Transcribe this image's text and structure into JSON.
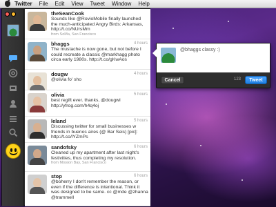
{
  "menubar": {
    "app_name": "Twitter",
    "items": [
      "File",
      "Edit",
      "View",
      "Tweet",
      "Window",
      "Help"
    ]
  },
  "sidebar": {
    "icons": [
      "home-icon",
      "speech-bubble-icon",
      "at-mention-icon",
      "inbox-icon",
      "person-icon",
      "list-icon",
      "search-icon",
      "smiley-icon"
    ]
  },
  "timeline": {
    "tweets": [
      {
        "username": "theSeanCook",
        "time": "",
        "text": "Sounds like @RovioMobile finally launched the much-anticipated Angry Birds: Arkansas, http://t.co/NUrsMm",
        "meta": "from SoMa, San Francisco"
      },
      {
        "username": "bhaggs",
        "time": "4 hours",
        "text": "The mustache is now gone, but not before I could recreate a classic @markhagg photo circa early 1980s. http://t.co/gKwAos",
        "meta": ""
      },
      {
        "username": "dougw",
        "time": "4 hours",
        "text": "@olivia fo' sho",
        "meta": ""
      },
      {
        "username": "olivia",
        "time": "5 hours",
        "text": "best regift ever. thanks, @dougwl  http://yfrog.com/h4q4oj",
        "meta": ""
      },
      {
        "username": "leland",
        "time": "5 hours",
        "text": "Discussing twitter for small businesses w friends in buenos aires (@ Bar Seis) [pic]: http://t.co/lYZmPs",
        "meta": ""
      },
      {
        "username": "sandofsky",
        "time": "6 hours",
        "text": "Cleaned up my apartment after last night's festivities, thus completing my resolution.",
        "meta": "from Mission Bay, San Francisco"
      },
      {
        "username": "stop",
        "time": "6 hours",
        "text": "@boherry I don't remember the reason, or even if the difference is intentional. Think it was designed to be same. cc @mde @zhanna @trammell",
        "meta": ""
      }
    ]
  },
  "compose": {
    "text": "@bhaggs classy :)",
    "cancel_label": "Cancel",
    "char_count": "123",
    "tweet_label": "Tweet"
  }
}
